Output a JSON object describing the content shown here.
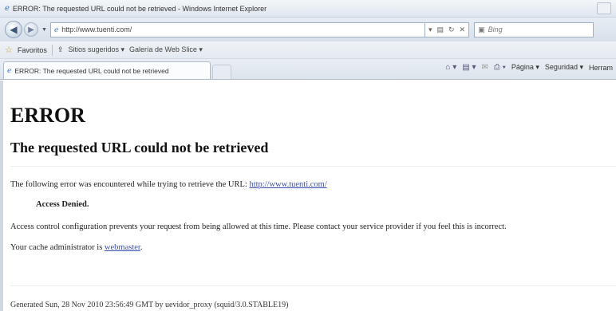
{
  "window": {
    "title": "ERROR: The requested URL could not be retrieved - Windows Internet Explorer"
  },
  "address_bar": {
    "url": "http://www.tuenti.com/",
    "search_placeholder": "Bing"
  },
  "favorites_bar": {
    "favorites_label": "Favoritos",
    "suggested_sites_label": "Sitios sugeridos ▾",
    "web_slice_label": "Galería de Web Slice ▾"
  },
  "tab": {
    "title": "ERROR: The requested URL could not be retrieved"
  },
  "command_bar": {
    "page_label": "Página ▾",
    "safety_label": "Seguridad ▾",
    "tools_label": "Herram"
  },
  "page": {
    "heading": "ERROR",
    "subheading": "The requested URL could not be retrieved",
    "error_intro": "The following error was encountered while trying to retrieve the URL:",
    "error_url": "http://www.tuenti.com/",
    "error_title": "Access Denied.",
    "error_detail": "Access control configuration prevents your request from being allowed at this time. Please contact your service provider if you feel this is incorrect.",
    "admin_text": "Your cache administrator is",
    "admin_link": "webmaster",
    "footer": "Generated Sun, 28 Nov 2010 23:56:49 GMT by uevidor_proxy (squid/3.0.STABLE19)"
  },
  "icons": {
    "back": "back-arrow-icon",
    "forward": "forward-arrow-icon",
    "favorites": "star-icon",
    "page": "ie-page-icon"
  },
  "colors": {
    "chrome_light": "#e7edf4",
    "link": "#3d4fae"
  }
}
